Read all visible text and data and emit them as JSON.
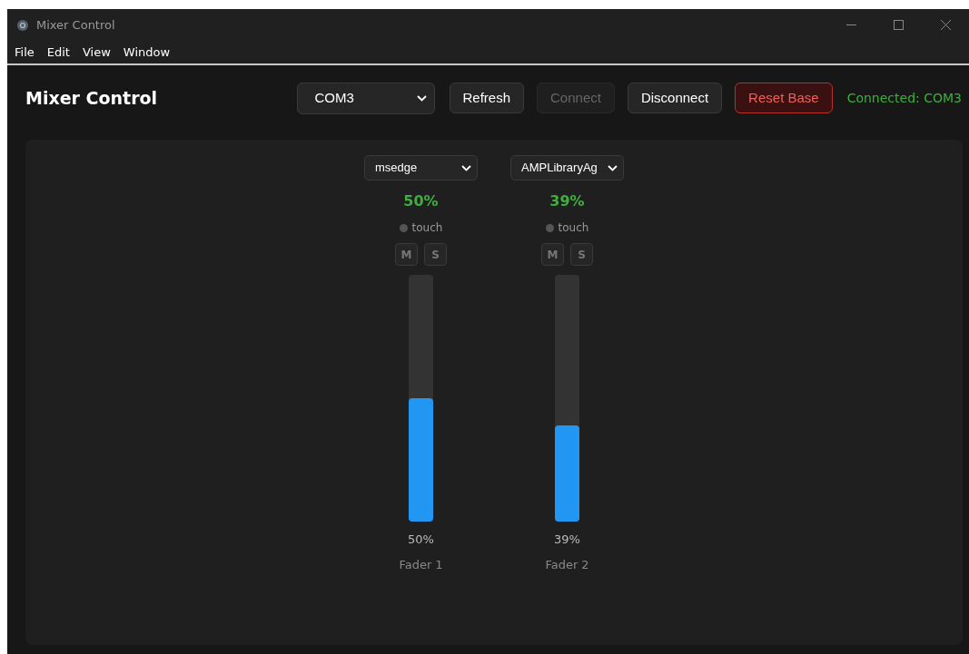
{
  "window": {
    "title": "Mixer Control"
  },
  "menu": [
    "File",
    "Edit",
    "View",
    "Window"
  ],
  "header": {
    "title": "Mixer Control",
    "port": "COM3",
    "buttons": [
      {
        "label": "Refresh",
        "kind": "default",
        "disabled": false
      },
      {
        "label": "Connect",
        "kind": "default",
        "disabled": true
      },
      {
        "label": "Disconnect",
        "kind": "default",
        "disabled": false
      },
      {
        "label": "Reset Base",
        "kind": "danger",
        "disabled": false
      }
    ],
    "status": "Connected: COM3"
  },
  "channels": [
    {
      "app": "msedge",
      "percent": "50%",
      "touch_label": "touch",
      "touched": false,
      "mute_label": "M",
      "muted": false,
      "solo_label": "S",
      "soloed": false,
      "level": 0.5,
      "reading": "50%",
      "name": "Fader 1"
    },
    {
      "app": "AMPLibraryAg",
      "percent": "39%",
      "touch_label": "touch",
      "touched": false,
      "mute_label": "M",
      "muted": false,
      "solo_label": "S",
      "soloed": false,
      "level": 0.39,
      "reading": "39%",
      "name": "Fader 2"
    }
  ]
}
